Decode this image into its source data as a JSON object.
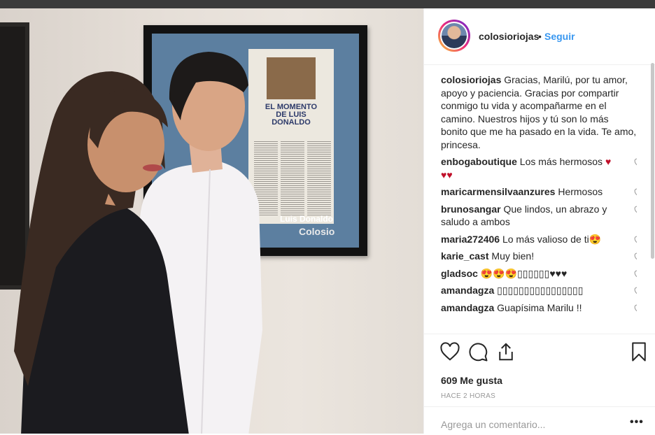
{
  "header": {
    "username": "colosioriojas",
    "separator": "•",
    "follow_label": "Seguir"
  },
  "caption": {
    "username": "colosioriojas",
    "text": "Gracias, Marilú, por tu amor, apoyo y paciencia. Gracias por compartir conmigo tu vida y acompañarme en el camino. Nuestros hijos y tú son lo más bonito que me ha pasado en la vida. Te amo, princesa."
  },
  "comments": [
    {
      "user": "enbogaboutique",
      "text": "Los más hermosos ♥ ♥♥"
    },
    {
      "user": "maricarmensilvaanzures",
      "text": "Hermosos"
    },
    {
      "user": "brunosangar",
      "text": "Que lindos, un abrazo y saludo a ambos"
    },
    {
      "user": "maria272406",
      "text": "Lo más valioso de ti😍"
    },
    {
      "user": "karie_cast",
      "text": "Muy bien!"
    },
    {
      "user": "gladsoc",
      "text": "😍😍😍▯▯▯▯▯▯♥♥♥"
    },
    {
      "user": "amandagza",
      "text": "▯▯▯▯▯▯▯▯▯▯▯▯▯▯▯▯"
    },
    {
      "user": "amandagza",
      "text": "Guapísima Marilu !!"
    }
  ],
  "likes_label": "609 Me gusta",
  "timestamp": "HACE 2 HORAS",
  "comment_placeholder": "Agrega un comentario...",
  "more_label": "•••",
  "frame": {
    "headline": "EL MOMENTO DE LUIS DONALDO",
    "sign_line1": "Luis Donaldo",
    "sign_line2": "Colosio"
  },
  "colors": {
    "accent": "#3897f0",
    "text": "#262626",
    "muted": "#999999",
    "heart": "#c0102a"
  },
  "icons": [
    "heart-icon",
    "comment-icon",
    "share-icon",
    "bookmark-icon",
    "more-options-icon"
  ]
}
